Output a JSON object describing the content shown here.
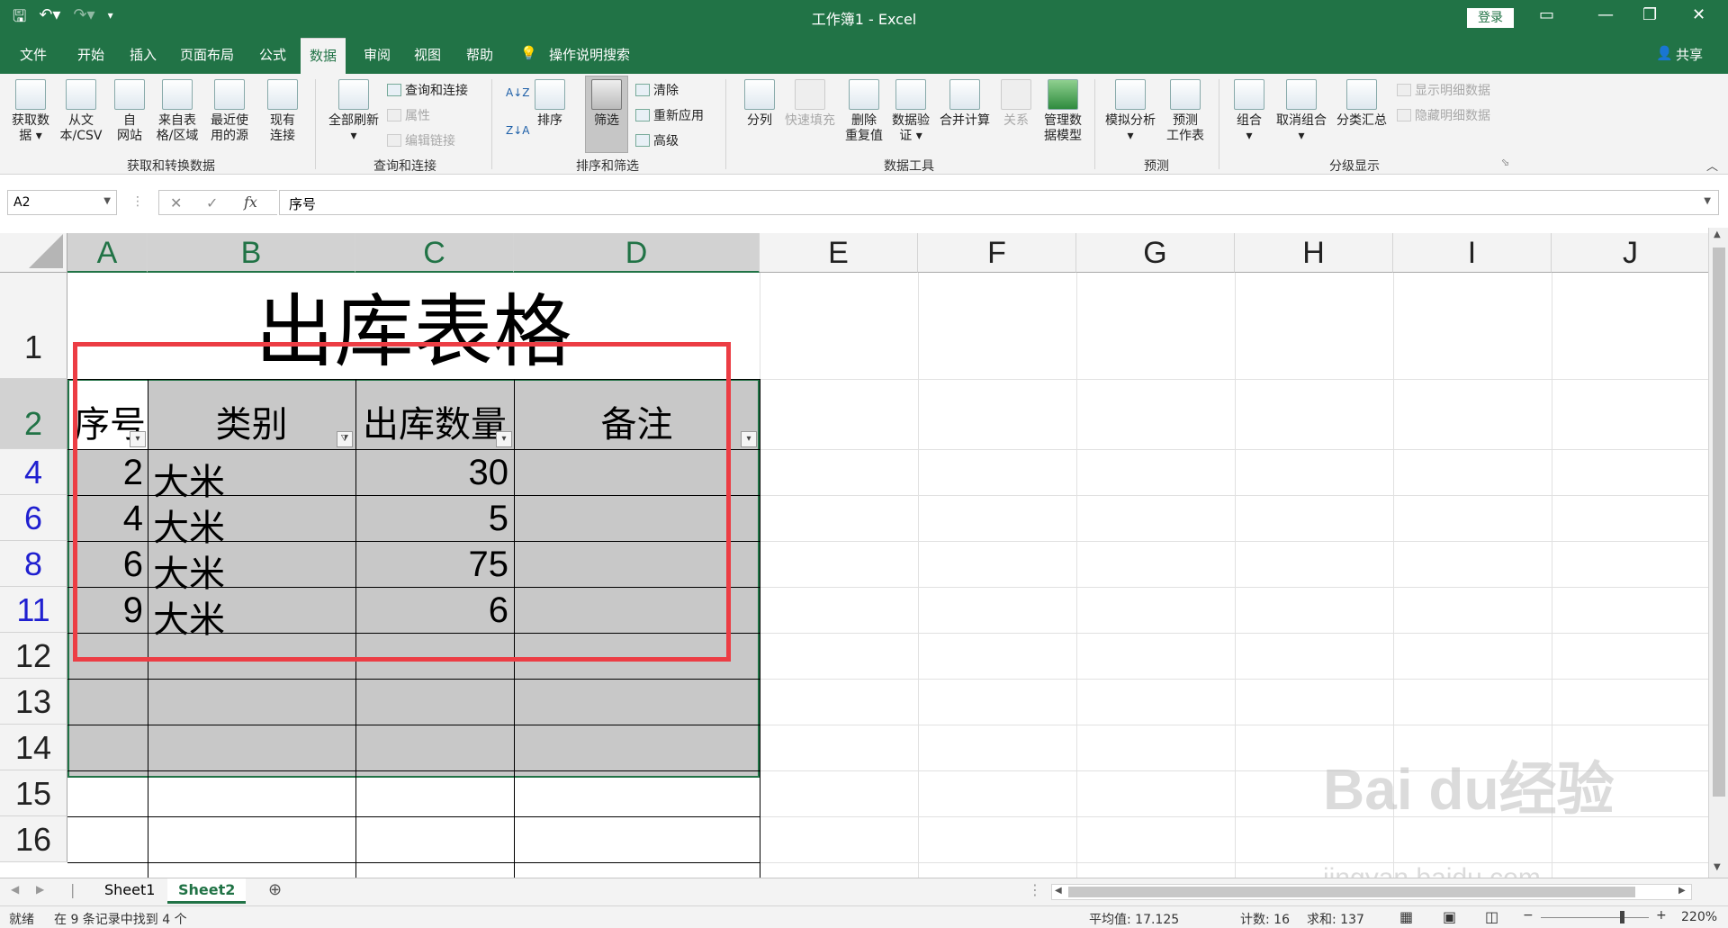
{
  "window": {
    "title": "工作簿1 - Excel",
    "login_label": "登录",
    "share_label": "共享",
    "accent_color": "#217346"
  },
  "tabs": [
    "文件",
    "开始",
    "插入",
    "页面布局",
    "公式",
    "数据",
    "审阅",
    "视图",
    "帮助"
  ],
  "active_tab": "数据",
  "tell_me": "操作说明搜索",
  "ribbon": {
    "get_transform": {
      "label": "获取和转换数据",
      "buttons": [
        {
          "l1": "获取数",
          "l2": "据 ▾"
        },
        {
          "l1": "从文",
          "l2": "本/CSV"
        },
        {
          "l1": "自",
          "l2": "网站"
        },
        {
          "l1": "来自表",
          "l2": "格/区域"
        },
        {
          "l1": "最近使",
          "l2": "用的源"
        },
        {
          "l1": "现有",
          "l2": "连接"
        }
      ]
    },
    "queries": {
      "label": "查询和连接",
      "refresh_all": {
        "l1": "全部刷新",
        "l2": "▾"
      },
      "items": [
        "查询和连接",
        "属性",
        "编辑链接"
      ]
    },
    "sort_filter": {
      "label": "排序和筛选",
      "sort": "排序",
      "filter": "筛选",
      "items": [
        "清除",
        "重新应用",
        "高级"
      ]
    },
    "data_tools": {
      "label": "数据工具",
      "buttons": [
        {
          "l1": "分列",
          "l2": ""
        },
        {
          "l1": "快速填充",
          "l2": ""
        },
        {
          "l1": "删除",
          "l2": "重复值"
        },
        {
          "l1": "数据验",
          "l2": "证 ▾"
        },
        {
          "l1": "合并计算",
          "l2": ""
        },
        {
          "l1": "关系",
          "l2": ""
        },
        {
          "l1": "管理数",
          "l2": "据模型"
        }
      ]
    },
    "forecast": {
      "label": "预测",
      "buttons": [
        {
          "l1": "模拟分析",
          "l2": "▾"
        },
        {
          "l1": "预测",
          "l2": "工作表"
        }
      ]
    },
    "outline": {
      "label": "分级显示",
      "buttons": [
        {
          "l1": "组合",
          "l2": "▾"
        },
        {
          "l1": "取消组合",
          "l2": "▾"
        },
        {
          "l1": "分类汇总",
          "l2": ""
        }
      ],
      "items": [
        "显示明细数据",
        "隐藏明细数据"
      ]
    }
  },
  "formula_bar": {
    "name_box": "A2",
    "formula": "序号",
    "fx": "fx"
  },
  "columns": [
    "A",
    "B",
    "C",
    "D",
    "E",
    "F",
    "G",
    "H",
    "I",
    "J"
  ],
  "rows": [
    "1",
    "2",
    "4",
    "6",
    "8",
    "11",
    "12",
    "13",
    "14",
    "15",
    "16"
  ],
  "sheet": {
    "title": "出库表格",
    "headers": [
      "序号",
      "类别",
      "出库数量",
      "备注"
    ],
    "data": [
      [
        "2",
        "大米",
        "30",
        ""
      ],
      [
        "4",
        "大米",
        "5",
        ""
      ],
      [
        "6",
        "大米",
        "75",
        ""
      ],
      [
        "9",
        "大米",
        "6",
        ""
      ]
    ]
  },
  "sheet_tabs": [
    "Sheet1",
    "Sheet2"
  ],
  "active_sheet": "Sheet2",
  "status": {
    "ready": "就绪",
    "found": "在 9 条记录中找到 4 个",
    "average": "平均值: 17.125",
    "count": "计数: 16",
    "sum": "求和: 137",
    "zoom": "220%"
  },
  "watermark": {
    "main": "Bai du经验",
    "sub": "jingyan.baidu.com"
  }
}
